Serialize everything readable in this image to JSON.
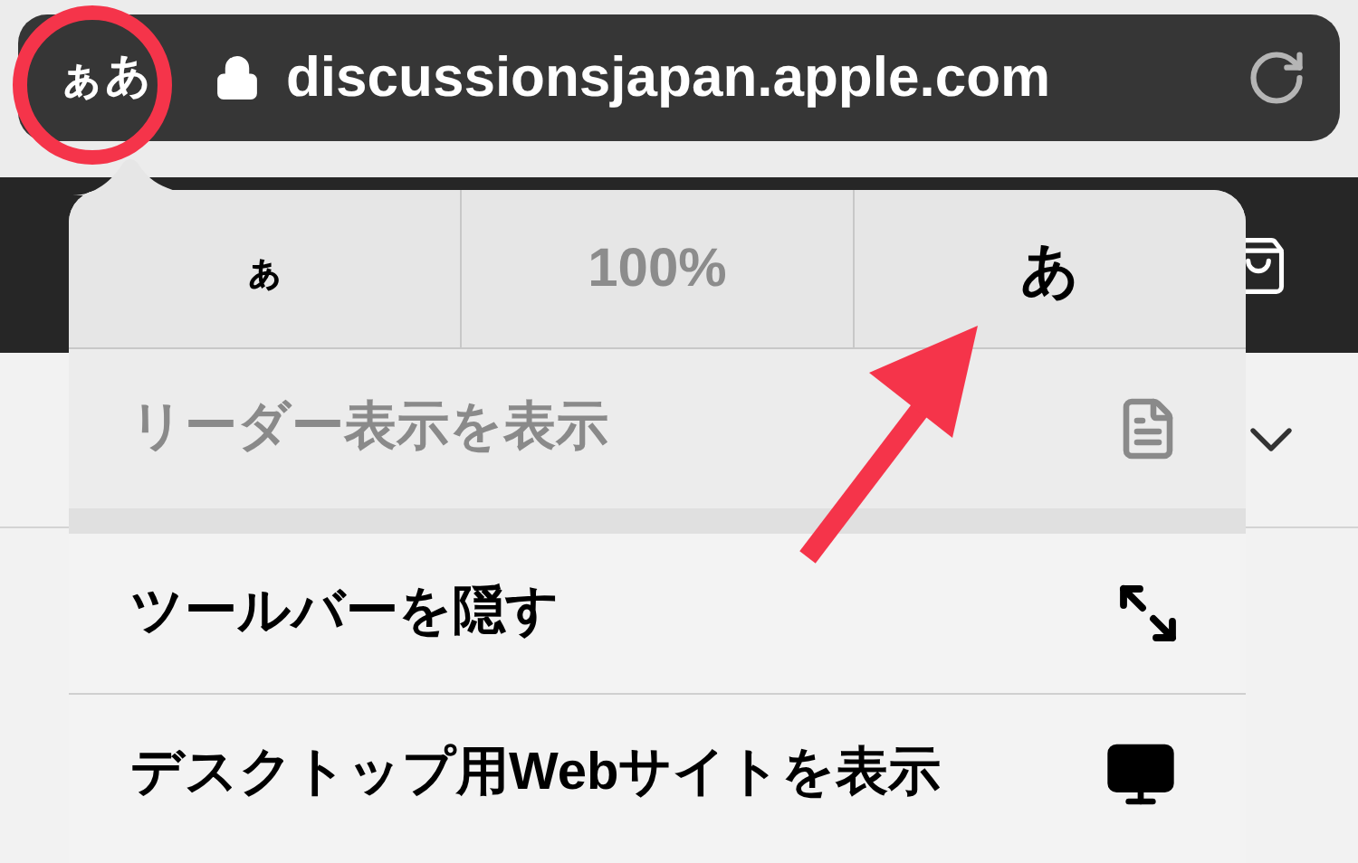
{
  "address_bar": {
    "text_size_button": "ぁあ",
    "url": "discussionsjapan.apple.com"
  },
  "menu": {
    "text_size": [
      {
        "kind": "smaller",
        "label": "ぁ"
      },
      {
        "kind": "zoom",
        "label": "100%"
      },
      {
        "kind": "larger",
        "label": "あ"
      }
    ],
    "items": [
      {
        "label": "リーダー表示を表示",
        "disabled": true,
        "kind": "reader"
      },
      {
        "label": "ツールバーを隠す",
        "disabled": false,
        "kind": "toolbar"
      },
      {
        "label": "デスクトップ用Webサイトを表示",
        "disabled": false,
        "kind": "desktop"
      }
    ]
  }
}
